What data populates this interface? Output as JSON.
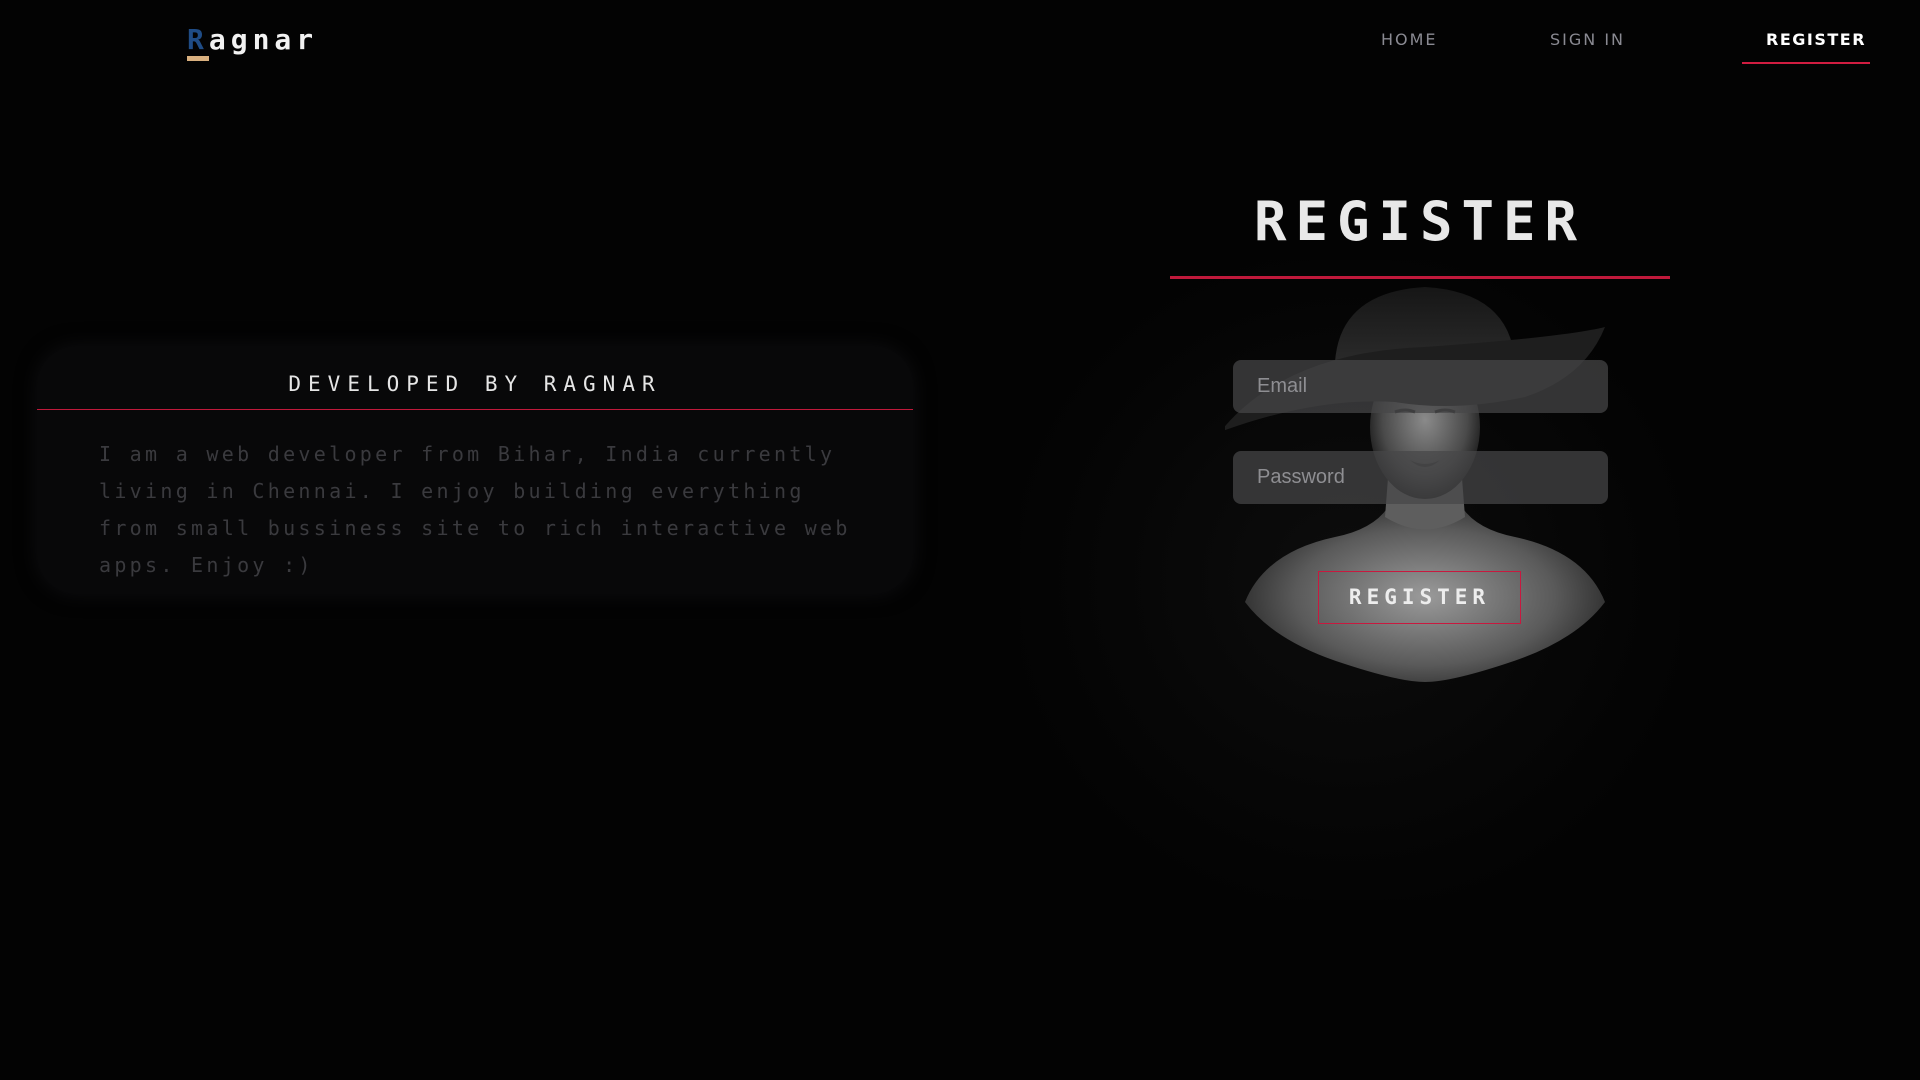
{
  "brand": {
    "logo_first": "R",
    "logo_rest": "agnar",
    "first_letter_color": "#1f4c86",
    "underline_color": "#d9b07f"
  },
  "nav": {
    "items": [
      {
        "label": "HOME",
        "active": false
      },
      {
        "label": "SIGN IN",
        "active": false
      },
      {
        "label": "REGISTER",
        "active": true
      }
    ],
    "accent_color": "#d01c40"
  },
  "about": {
    "title": "DEVELOPED BY RAGNAR",
    "body": "I am a web developer from Bihar, India currently living in Chennai. I enjoy building everything from small bussiness site to rich interactive web apps. Enjoy :)"
  },
  "register": {
    "title": "REGISTER",
    "email_placeholder": "Email",
    "password_placeholder": "Password",
    "button_label": "REGISTER",
    "accent_color": "#c0193b"
  }
}
